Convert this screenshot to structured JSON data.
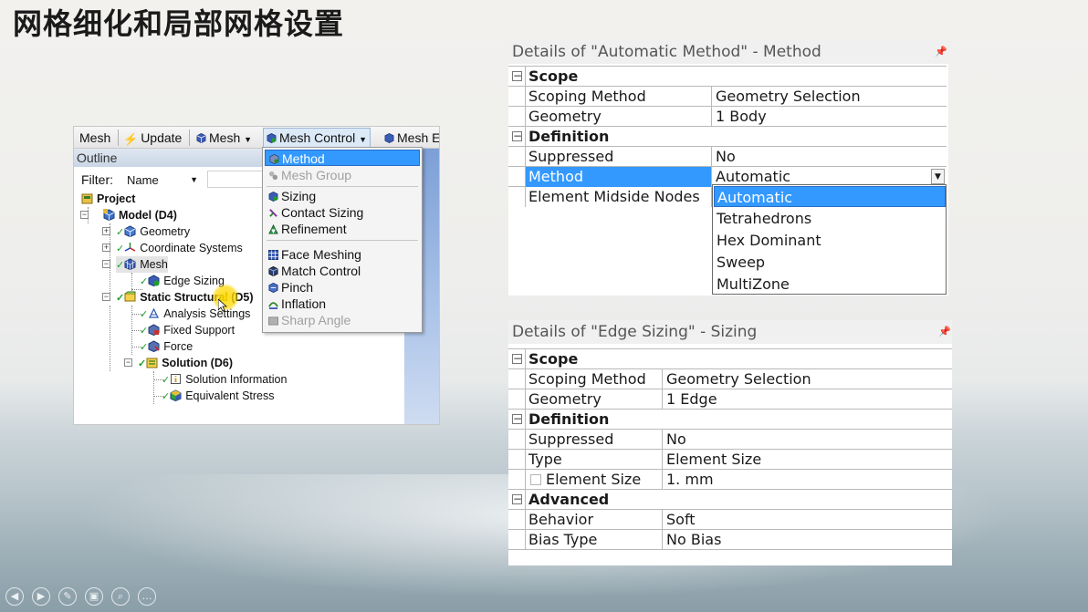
{
  "slide": {
    "title": "网格细化和局部网格设置"
  },
  "toolbar": {
    "mesh_label": "Mesh",
    "update_label": "Update",
    "mesh_menu_label": "Mesh",
    "mesh_control_label": "Mesh Control",
    "mesh_edit_label": "Mesh E"
  },
  "outline": {
    "title": "Outline",
    "filter_label": "Filter:",
    "filter_value": "Name",
    "tree": [
      {
        "label": "Project"
      },
      {
        "label": "Model (D4)"
      },
      {
        "label": "Geometry"
      },
      {
        "label": "Coordinate Systems"
      },
      {
        "label": "Mesh"
      },
      {
        "label": "Edge Sizing"
      },
      {
        "label": "Static Structural (D5)"
      },
      {
        "label": "Analysis Settings"
      },
      {
        "label": "Fixed Support"
      },
      {
        "label": "Force"
      },
      {
        "label": "Solution (D6)"
      },
      {
        "label": "Solution Information"
      },
      {
        "label": "Equivalent Stress"
      }
    ]
  },
  "mesh_control_menu": {
    "items": [
      {
        "label": "Method"
      },
      {
        "label": "Mesh Group"
      },
      {
        "label": "Sizing"
      },
      {
        "label": "Contact Sizing"
      },
      {
        "label": "Refinement"
      },
      {
        "label": "Face Meshing"
      },
      {
        "label": "Match Control"
      },
      {
        "label": "Pinch"
      },
      {
        "label": "Inflation"
      },
      {
        "label": "Sharp Angle"
      }
    ]
  },
  "method_details": {
    "title": "Details of \"Automatic Method\" - Method",
    "rows": [
      {
        "label": "Scope",
        "value": ""
      },
      {
        "label": "Scoping Method",
        "value": "Geometry Selection"
      },
      {
        "label": "Geometry",
        "value": "1 Body"
      },
      {
        "label": "Definition",
        "value": ""
      },
      {
        "label": "Suppressed",
        "value": "No"
      },
      {
        "label": "Method",
        "value": "Automatic"
      },
      {
        "label": "Element Midside Nodes",
        "value": ""
      }
    ],
    "method_options": [
      "Automatic",
      "Tetrahedrons",
      "Hex Dominant",
      "Sweep",
      "MultiZone"
    ]
  },
  "sizing_details": {
    "title": "Details of \"Edge Sizing\" - Sizing",
    "rows": [
      {
        "label": "Scope",
        "value": ""
      },
      {
        "label": "Scoping Method",
        "value": "Geometry Selection"
      },
      {
        "label": "Geometry",
        "value": "1 Edge"
      },
      {
        "label": "Definition",
        "value": ""
      },
      {
        "label": "Suppressed",
        "value": "No"
      },
      {
        "label": "Type",
        "value": "Element Size"
      },
      {
        "label": "Element Size",
        "value": "1. mm"
      },
      {
        "label": "Advanced",
        "value": ""
      },
      {
        "label": "Behavior",
        "value": "Soft"
      },
      {
        "label": "Bias Type",
        "value": "No Bias"
      }
    ]
  },
  "colors": {
    "selection": "#3399ff",
    "check_green": "#1e9e2a",
    "mesh_icon": "#2f4fa8"
  },
  "icons": {
    "pin": "pushpin-icon",
    "collapse": "minus-box-icon",
    "expand": "plus-box-icon",
    "check": "checkmark-icon"
  }
}
